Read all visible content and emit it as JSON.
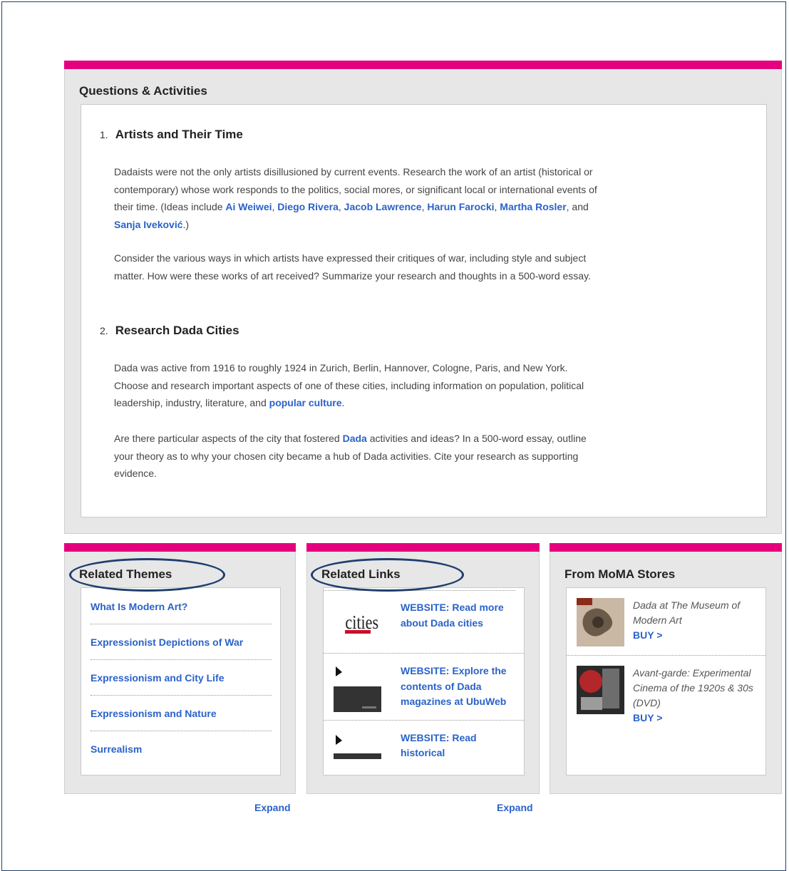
{
  "qa": {
    "title": "Questions & Activities",
    "q1": {
      "num": "1.",
      "title": "Artists and Their Time",
      "p1_a": "Dadaists were not the only artists disillusioned by current events. Research the work of an artist (historical or contemporary) whose work responds to the politics, social mores, or significant local or international events of their time. (Ideas include ",
      "links": [
        "Ai Weiwei",
        "Diego Rivera",
        "Jacob Lawrence",
        "Harun Farocki",
        "Martha Rosler",
        "Sanja Iveković"
      ],
      "p2": "Consider the various ways in which artists have expressed their critiques of war, including style and subject matter. How were these works of art received? Summarize your research and thoughts in a 500-word essay."
    },
    "q2": {
      "num": "2.",
      "title": "Research Dada Cities",
      "p1_a": "Dada was active from 1916 to roughly 1924 in Zurich, Berlin, Hannover, Cologne, Paris, and New York. Choose and research important aspects of one of these cities, including information on population, political leadership, industry, literature, and ",
      "p1_link": "popular culture",
      "p2_a": "Are there particular aspects of the city that fostered ",
      "p2_link": "Dada",
      "p2_b": " activities and ideas? In a 500-word essay, outline your theory as to why your chosen city became a hub of Dada activities. Cite your research as supporting evidence."
    }
  },
  "themes": {
    "title": "Related Themes",
    "items": [
      "What Is Modern Art?",
      "Expressionist Depictions of War",
      "Expressionism and City Life",
      "Expressionism and Nature",
      "Surrealism"
    ],
    "expand": "Expand"
  },
  "links": {
    "title": "Related Links",
    "items": [
      {
        "text": "WEBSITE: Read more about Dada cities",
        "thumb_label": "cities"
      },
      {
        "text": "WEBSITE: Explore the contents of Dada magazines at UbuWeb"
      },
      {
        "text": "WEBSITE: Read historical"
      }
    ],
    "expand": "Expand"
  },
  "stores": {
    "title": "From MoMA Stores",
    "items": [
      {
        "title": "Dada at The Museum of Modern Art",
        "buy": "BUY >"
      },
      {
        "title": "Avant-garde: Experimental Cinema of the 1920s & 30s (DVD)",
        "buy": "BUY >"
      }
    ]
  },
  "colors": {
    "accent": "#e5007e",
    "link": "#2a62c9",
    "panel_bg": "#e7e7e7",
    "annotation": "#1f3f6e"
  }
}
